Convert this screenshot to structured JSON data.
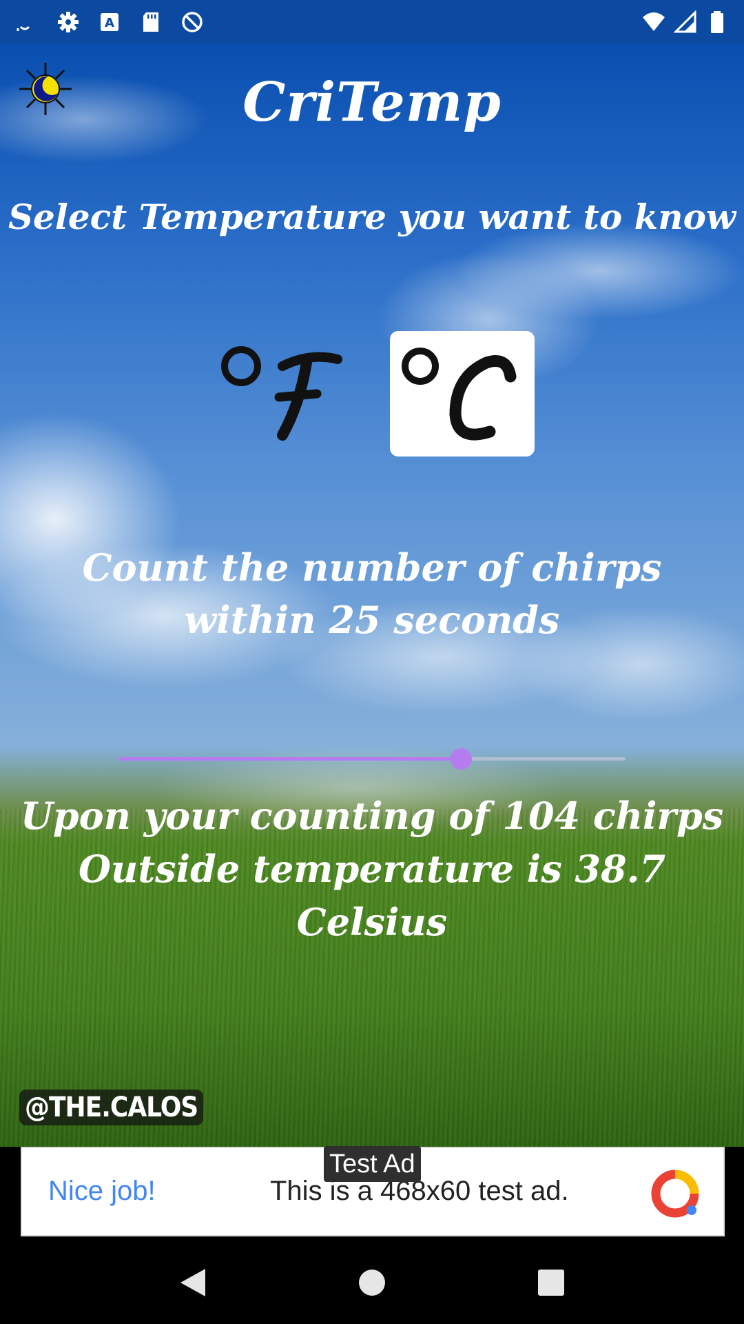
{
  "status_bar": {
    "left_icons": [
      "missed-call-icon",
      "gear-icon",
      "keyboard-a-icon",
      "sd-card-icon",
      "do-not-disturb-icon"
    ],
    "right_icons": [
      "wifi-icon",
      "signal-icon",
      "battery-icon"
    ]
  },
  "app": {
    "title": "CriTemp",
    "subtitle": "Select Temperature you want to know",
    "units": {
      "fahrenheit_label": "°F",
      "celsius_label": "°C",
      "selected": "celsius"
    },
    "instruction_line1": "Count the number of chirps",
    "instruction_line2": "within 25 seconds",
    "slider": {
      "value": 104,
      "min": 0,
      "max": 154,
      "accent": "#b57cf0"
    },
    "result_line1": "Upon your counting of 104 chirps",
    "result_line2": "Outside temperature is 38.7 Celsius",
    "watermark": "@THE.CALOS"
  },
  "ad": {
    "badge": "Test Ad",
    "headline": "Nice job!",
    "body": "This is a 468x60 test ad."
  },
  "nav": {
    "buttons": [
      "back-icon",
      "home-icon",
      "recents-icon"
    ]
  }
}
